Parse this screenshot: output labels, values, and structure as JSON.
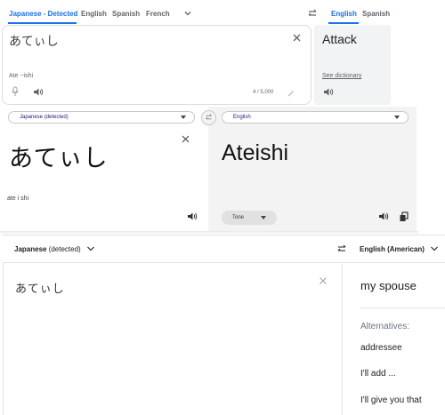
{
  "google": {
    "tabs": [
      "Japanese - Detected",
      "English",
      "Spanish",
      "French"
    ],
    "target_tabs": [
      "English",
      "Spanish"
    ],
    "source_text": "あてぃし",
    "transliteration": "Ate ~ishi",
    "char_count": "4 / 5,000",
    "translation": "Attack",
    "see_dictionary": "See dictionary"
  },
  "bing": {
    "source_lang": "Japanese (detected)",
    "target_lang": "English",
    "source_text": "あてぃし",
    "transliteration": "ate i shi",
    "translation": "Ateishi",
    "tone_label": "Tone"
  },
  "deepl": {
    "source_lang_main": "Japanese",
    "source_lang_suffix": " (detected)",
    "target_lang": "English (American)",
    "source_text": "あてぃし",
    "translation": "my spouse",
    "alternatives_label": "Alternatives:",
    "alternatives": [
      "addressee",
      "I'll add ...",
      "I'll give you that"
    ]
  },
  "colors": {
    "google_accent": "#1a73e8",
    "bing_accent": "#1e1a78",
    "deepl_text": "#1b1e25"
  },
  "icons": [
    "chevron-down-icon",
    "swap-icon",
    "close-icon",
    "mic-icon",
    "speaker-icon",
    "pencil-icon",
    "copy-icon"
  ]
}
